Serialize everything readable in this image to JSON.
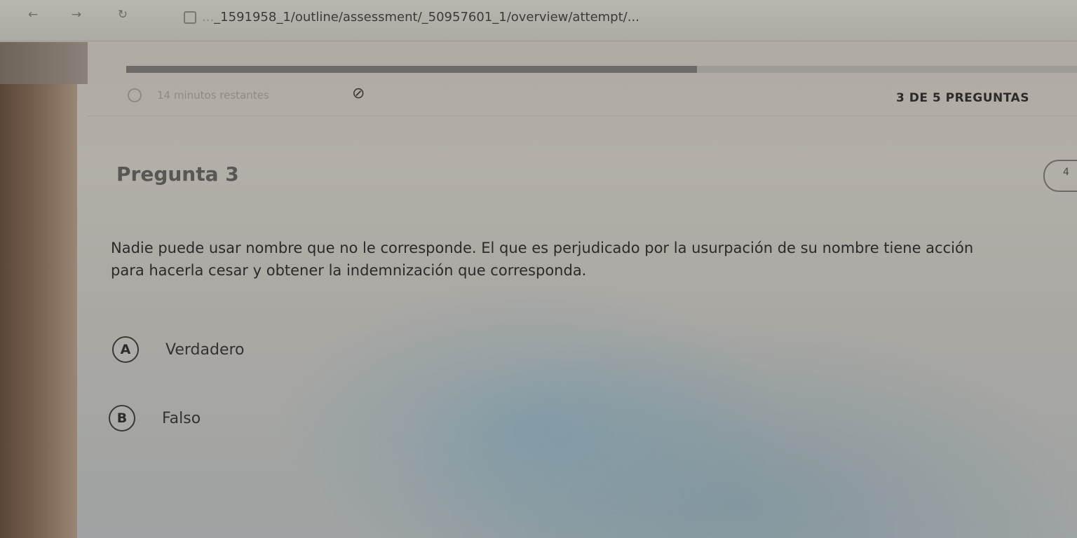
{
  "browser": {
    "url_faded": "...",
    "url_main": "_1591958_1/outline/assessment/_50957601_1/overview/attempt/...",
    "back_icon": "back-arrow-icon",
    "forward_icon": "forward-arrow-icon",
    "reload_icon": "reload-icon"
  },
  "assessment": {
    "progress_fraction": 0.6,
    "timer_text": "14 minutos restantes",
    "question_count": "3 DE 5 PREGUNTAS",
    "question_title": "Pregunta 3",
    "points": "4",
    "question_lines": [
      "Nadie puede usar nombre que no le corresponde. El que es perjudicado por la usurpación de su nombre tiene acción",
      "para hacerla cesar y obtener la indemnización que corresponda."
    ],
    "options": [
      {
        "letter": "A",
        "label": "Verdadero"
      },
      {
        "letter": "B",
        "label": "Falso"
      }
    ]
  }
}
